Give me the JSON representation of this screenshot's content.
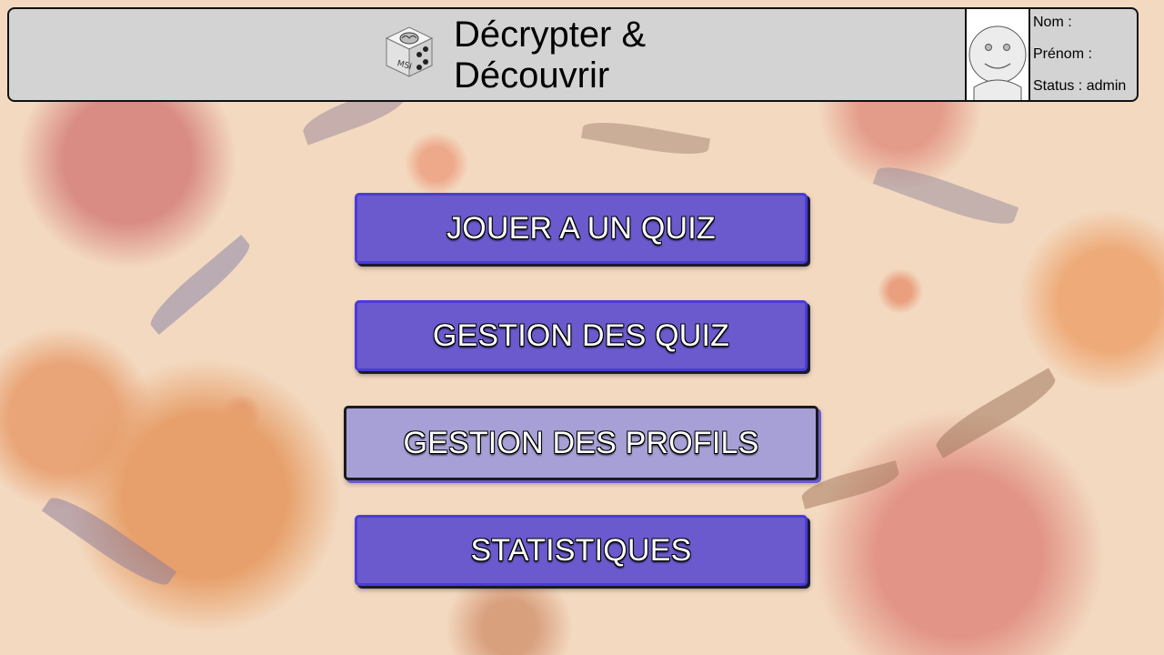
{
  "header": {
    "title_line1": "Décrypter &",
    "title_line2": "Découvrir",
    "logo_icon": "dice-brain-icon",
    "avatar_icon": "user-avatar-icon"
  },
  "profile": {
    "nom_label": "Nom :",
    "prenom_label": "Prénom :",
    "status_label": "Status : admin"
  },
  "menu": {
    "play_quiz": "JOUER A UN QUIZ",
    "manage_quiz": "GESTION DES QUIZ",
    "manage_profiles": "GESTION DES PROFILS",
    "statistics": "STATISTIQUES"
  },
  "colors": {
    "button_bg": "#6a5acd",
    "button_active_bg": "#a6a0d6",
    "header_bg": "#d3d3d3",
    "page_bg": "#f3d9c0"
  }
}
